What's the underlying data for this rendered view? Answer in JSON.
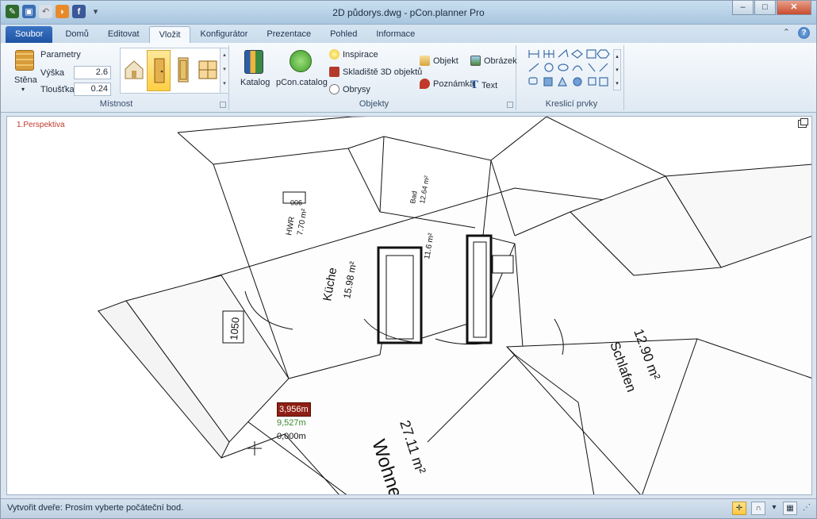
{
  "titlebar": {
    "title": "2D půdorys.dwg - pCon.planner Pro",
    "window_buttons": {
      "minimize": "–",
      "maximize": "□",
      "close": "✕"
    }
  },
  "ribbon_tabs": {
    "file": "Soubor",
    "tabs": [
      "Domů",
      "Editovat",
      "Vložit",
      "Konfigurátor",
      "Prezentace",
      "Pohled",
      "Informace"
    ],
    "active": "Vložit",
    "collapse_glyph": "⌃",
    "help_glyph": "?"
  },
  "ribbon": {
    "mistnost": {
      "title": "Místnost",
      "wall_button": "Stěna",
      "params_label": "Parametry",
      "height_label": "Výška",
      "height_value": "2.6",
      "thickness_label": "Tloušťka",
      "thickness_value": "0.24"
    },
    "objekty": {
      "title": "Objekty",
      "catalog": "Katalog",
      "pcon_catalog": "pCon.catalog",
      "inspiration": "Inspirace",
      "warehouse": "Skladiště 3D objektů",
      "outlines": "Obrysy",
      "object": "Objekt",
      "note": "Poznámka",
      "image": "Obrázek",
      "text": "Text"
    },
    "kresleni": {
      "title": "Kreslicí prvky"
    }
  },
  "viewport": {
    "label": "1.Perspektiva",
    "rooms": [
      {
        "name": "Wohnen",
        "area": "27.11 m²"
      },
      {
        "name": "Küche",
        "area": "15.98 m²"
      },
      {
        "name": "Schlafen",
        "area": "12.90 m²"
      },
      {
        "name": "HWR",
        "area": "7.70 m²"
      },
      {
        "name": "Bad",
        "area": "12.64 m²"
      },
      {
        "name": "",
        "area": "11.6 m²"
      }
    ],
    "door_dims": [
      "1050",
      "900"
    ],
    "measure": {
      "x": "3,956m",
      "y": "9,527m",
      "z": "0,000m"
    }
  },
  "status": {
    "message": "Vytvořit dveře: Prosím vyberte počáteční bod."
  },
  "colors": {
    "file_tab": "#1f54a3",
    "selection": "#ffcf45",
    "viewport_label": "#c0392b",
    "measure_x_bg": "#8e1f14",
    "measure_y": "#3a8a2e"
  }
}
